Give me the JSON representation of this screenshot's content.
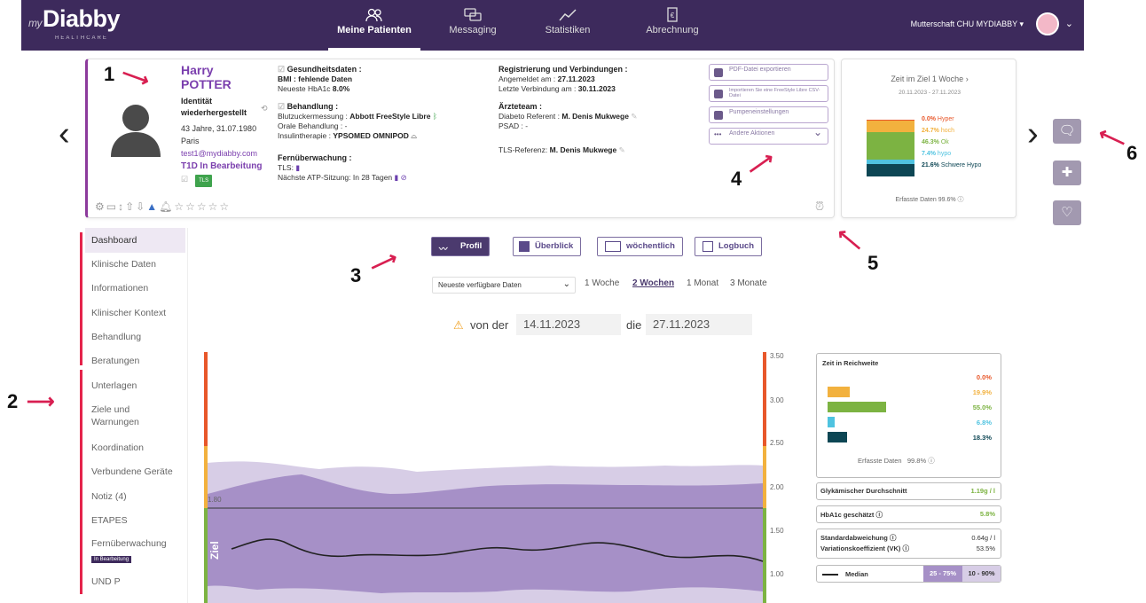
{
  "header": {
    "logo": "Diabby",
    "logo_prefix": "my",
    "logo_sub": "HEALTHCARE",
    "org": "Mutterschaft CHU MYDIABBY",
    "nav": [
      {
        "label": "Meine Patienten",
        "icon": "patients-icon"
      },
      {
        "label": "Messaging",
        "icon": "chat-icon"
      },
      {
        "label": "Statistiken",
        "icon": "stats-icon"
      },
      {
        "label": "Abrechnung",
        "icon": "invoice-icon"
      }
    ]
  },
  "patient": {
    "first_name": "Harry",
    "last_name": "POTTER",
    "status_line1": "Identität",
    "status_line2": "wiederhergestellt",
    "age": "43 Jahre, 31.07.1980",
    "city": "Paris",
    "email": "test1@mydiabby.com",
    "diabetes": "T1D",
    "process": "In Bearbeitung",
    "tls_badge": "TLS"
  },
  "health": {
    "title": "Gesundheitsdaten :",
    "bmi": "BMI : fehlende Daten",
    "hba1c_label": "Neueste HbA1c",
    "hba1c_value": "8.0%",
    "treat_title": "Behandlung :",
    "glucose_label": "Blutzuckermessung :",
    "glucose_value": "Abbott FreeStyle Libre",
    "oral": "Orale Behandlung : -",
    "insulin_label": "Insulintherapie :",
    "insulin_value": "YPSOMED OMNIPOD",
    "remote_title": "Fernüberwachung :",
    "tls": "TLS:",
    "atp": "Nächste ATP-Sitzung: In 28 Tagen"
  },
  "registration": {
    "title": "Registrierung und Verbindungen :",
    "registered_label": "Angemeldet am :",
    "registered_value": "27.11.2023",
    "last_label": "Letzte Verbindung am :",
    "last_value": "30.11.2023",
    "team_title": "Ärzteteam :",
    "referent_label": "Diabeto Referent :",
    "referent_value": "M. Denis Mukwege",
    "psad": "PSAD : -",
    "tls_ref_label": "TLS-Referenz:",
    "tls_ref_value": "M. Denis Mukwege"
  },
  "actions": [
    "PDF-Datei exportieren",
    "Importieren Sie eine FreeStyle Libre CSV-Datei",
    "Pumpeneinstellungen",
    "Andere Aktionen"
  ],
  "zeit": {
    "title": "Zeit im Ziel 1 Woche",
    "dates": "20.11.2023 - 27.11.2023",
    "rows": [
      {
        "pct": "0.0%",
        "label": "Hyper",
        "color": "#e8572a"
      },
      {
        "pct": "24.7%",
        "label": "hoch",
        "color": "#f2b13e"
      },
      {
        "pct": "46.3%",
        "label": "Ok",
        "color": "#7cb342"
      },
      {
        "pct": "7.4%",
        "label": "hypo",
        "color": "#4fc3e0"
      },
      {
        "pct": "21.6%",
        "label": "Schwere Hypo",
        "color": "#0d4654"
      }
    ],
    "captured_label": "Erfasste Daten",
    "captured_value": "99.6%"
  },
  "sidebar": {
    "items": [
      "Dashboard",
      "Klinische Daten",
      "Informationen",
      "Klinischer Kontext",
      "Behandlung",
      "Beratungen",
      "Unterlagen",
      "Ziele und Warnungen",
      "Koordination",
      "Verbundene Geräte",
      "Notiz (4)",
      "ETAPES",
      "Fernüberwachung",
      "UND P"
    ],
    "badge": "In Bearbeitung"
  },
  "tabs": [
    "Profil",
    "Überblick",
    "wöchentlich",
    "Logbuch"
  ],
  "select": {
    "value": "Neueste verfügbare Daten"
  },
  "periods": [
    "1 Woche",
    "2 Wochen",
    "1 Monat",
    "3 Monate"
  ],
  "dates": {
    "from_label": "von der",
    "from": "14.11.2023",
    "to_label": "die",
    "to": "27.11.2023"
  },
  "chart_data": {
    "type": "area",
    "target_label": "Ziel",
    "target_line": "1.80",
    "yticks": [
      "3.50",
      "3.00",
      "2.50",
      "2.00",
      "1.50",
      "1.00"
    ],
    "ylim": [
      0.8,
      3.5
    ]
  },
  "reichweite": {
    "title": "Zeit in Reichweite",
    "rows": [
      {
        "pct": "0.0%",
        "color": "#e8572a",
        "w": 0
      },
      {
        "pct": "19.9%",
        "color": "#f2b13e",
        "w": 25
      },
      {
        "pct": "55.0%",
        "color": "#7cb342",
        "w": 66
      },
      {
        "pct": "6.8%",
        "color": "#4fc3e0",
        "w": 8
      },
      {
        "pct": "18.3%",
        "color": "#0d4654",
        "w": 22
      }
    ],
    "captured_label": "Erfasste Daten",
    "captured_value": "99.8%"
  },
  "stats": {
    "glyk_label": "Glykämischer Durchschnitt",
    "glyk_value": "1.19g / l",
    "hba1c_label": "HbA1c geschätzt",
    "hba1c_value": "5.8%",
    "sd_label": "Standardabweichung",
    "sd_value": "0.64g / l",
    "vk_label": "Variationskoeffizient (VK)",
    "vk_value": "53.5%",
    "median": "Median",
    "p1": "25 - 75%",
    "p2": "10 - 90%"
  },
  "callouts": [
    "1",
    "2",
    "3",
    "4",
    "5",
    "6"
  ]
}
